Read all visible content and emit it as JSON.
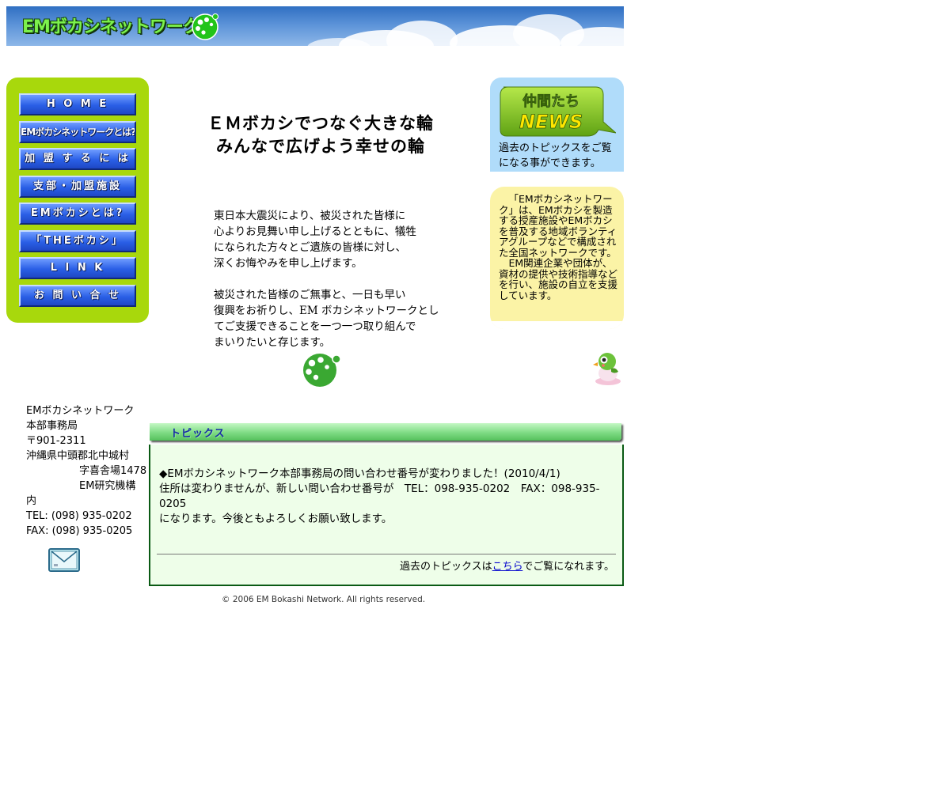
{
  "header": {
    "title": "EMボカシネットワーク"
  },
  "nav": {
    "items": [
      {
        "label": "H O M E"
      },
      {
        "label": "EMボカシネットワークとは?"
      },
      {
        "label": "加 盟 す る に は"
      },
      {
        "label": "支部・加盟施設"
      },
      {
        "label": "EMボカシとは?"
      },
      {
        "label": "「THEボカシ」"
      },
      {
        "label": "L I N K"
      },
      {
        "label": "お 問 い 合 せ"
      }
    ]
  },
  "main": {
    "headline_line1": "ＥＭボカシでつなぐ大きな輪",
    "headline_line2": "みんなで広げよう幸せの輪",
    "message1": [
      "東日本大震災により、被災された皆様に",
      "心よりお見舞い申し上げるとともに、犠牲",
      "になられた方々とご遺族の皆様に対し、",
      "深くお悔やみを申し上げます。"
    ],
    "message2": [
      "被災された皆様のご無事と、一日も早い",
      "復興をお祈りし、EM ボカシネットワークとし",
      "てご支援できることを一つ一つ取り組んで",
      "まいりたいと存じます。"
    ]
  },
  "news": {
    "badge_line1": "仲間たち",
    "badge_line2": "NEWS",
    "text": "過去のトピックスをご覧になる事ができます。"
  },
  "about": {
    "paragraph1": "「EMボカシネットワーク」は、EMボカシを製造する授産施設やEMボカシを普及する地域ボランティアグループなどで構成された全国ネットワークです。",
    "paragraph2": "EM関連企業や団体が、資材の提供や技術指導などを行い、施設の自立を支援しています。"
  },
  "address": {
    "line1": "EMボカシネットワーク",
    "line2": "本部事務局",
    "line3": "〒901-2311",
    "line4": "沖縄県中頭郡北中城村",
    "line5": "字喜舎場1478",
    "line6": "EM研究機構",
    "line7": "内",
    "tel": "TEL: (098) 935-0202",
    "fax": "FAX: (098) 935-0205"
  },
  "topics": {
    "title": "トピックス",
    "item_line1": "◆EMボカシネットワーク本部事務局の問い合わせ番号が変わりました！(2010/4/1)",
    "item_line2": "住所は変わりませんが、新しい問い合わせ番号が　TEL：098-935-0202　FAX：098-935-0205",
    "item_line3": "になります。今後ともよろしくお願い致します。",
    "more_prefix": "過去のトピックスは",
    "more_link": "こちら",
    "more_suffix": "でご覧になれます。"
  },
  "footer": {
    "copyright": "© 2006 EM Bokashi Network. All rights reserved."
  },
  "colors": {
    "nav_panel": "#a8d80c",
    "nav_button": "#2a5fe6",
    "news_panel": "#b0dcfa",
    "about_panel": "#fbf3a6",
    "topics_panel": "#eefee9",
    "topics_border": "#0a5a14"
  },
  "icons": {
    "logo": "em-dots-logo",
    "mail": "envelope-icon",
    "mascot": "bird-mascot"
  }
}
